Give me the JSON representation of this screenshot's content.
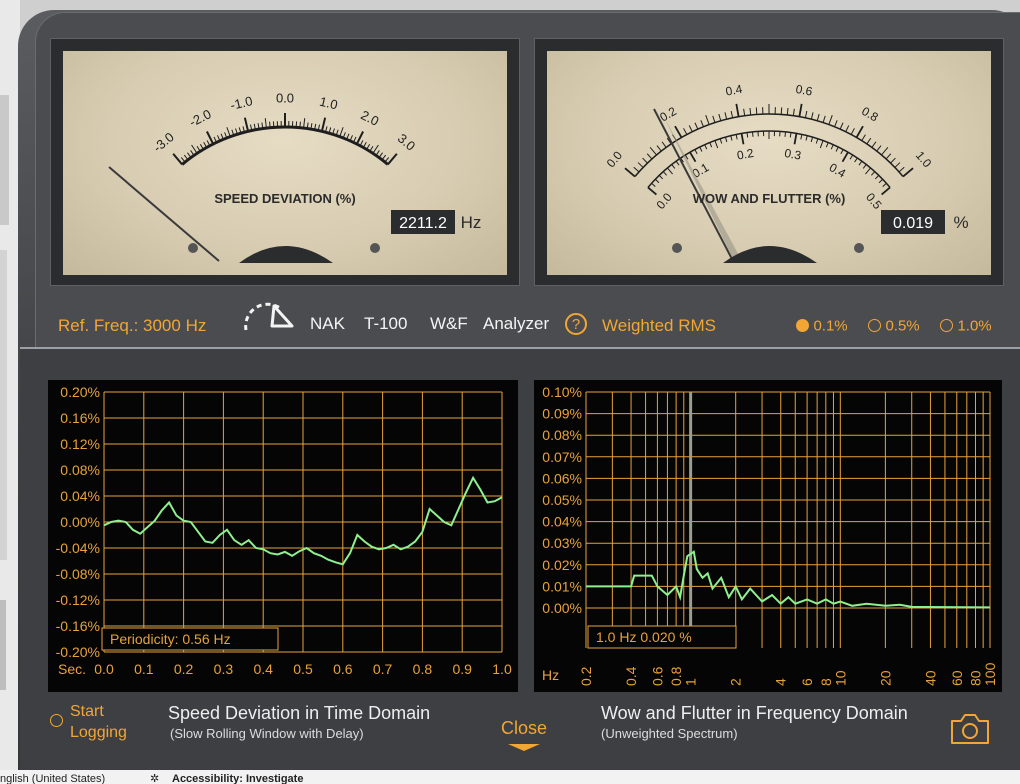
{
  "meters": {
    "speed": {
      "ticks": [
        "-3.0",
        "-2.0",
        "-1.0",
        "0.0",
        "1.0",
        "2.0",
        "3.0"
      ],
      "title": "SPEED DEVIATION (%)",
      "readout": "2211.2",
      "unit": "Hz"
    },
    "wow": {
      "outer_ticks": [
        "0.0",
        "0.2",
        "0.4",
        "0.6",
        "0.8",
        "1.0"
      ],
      "inner_ticks": [
        "0.0",
        "0.1",
        "0.2",
        "0.3",
        "0.4",
        "0.5"
      ],
      "title": "WOW AND FLUTTER (%)",
      "readout": "0.019",
      "unit": "%"
    }
  },
  "controls": {
    "ref_freq": "Ref. Freq.: 3000 Hz",
    "standards": [
      "NAK",
      "T-100",
      "W&F",
      "Analyzer"
    ],
    "help": "?",
    "weighting": "Weighted RMS",
    "ranges": [
      "0.1%",
      "0.5%",
      "1.0%"
    ],
    "selected_range": "0.1%"
  },
  "time_plot": {
    "y_labels": [
      "0.20%",
      "0.16%",
      "0.12%",
      "0.08%",
      "0.04%",
      "0.00%",
      "-0.04%",
      "-0.08%",
      "-0.12%",
      "-0.16%",
      "-0.20%"
    ],
    "x_title": "Sec.",
    "x_labels": [
      "0.0",
      "0.1",
      "0.2",
      "0.3",
      "0.4",
      "0.5",
      "0.6",
      "0.7",
      "0.8",
      "0.9",
      "1.0"
    ],
    "info": "Periodicity:   0.56 Hz",
    "caption": "Speed Deviation in Time Domain",
    "subcaption": "(Slow Rolling Window with Delay)"
  },
  "freq_plot": {
    "y_labels": [
      "0.10%",
      "0.09%",
      "0.08%",
      "0.07%",
      "0.06%",
      "0.05%",
      "0.04%",
      "0.03%",
      "0.02%",
      "0.01%",
      "0.00%"
    ],
    "x_title": "Hz",
    "x_labels": [
      "0.2",
      "0.4",
      "0.6",
      "0.8",
      "1",
      "2",
      "4",
      "6",
      "8",
      "10",
      "20",
      "40",
      "60",
      "80",
      "100"
    ],
    "info": "1.0 Hz        0.020 %",
    "caption": "Wow and Flutter in Frequency Domain",
    "subcaption": "(Unweighted Spectrum)"
  },
  "footer": {
    "start_logging": [
      "Start",
      "Logging"
    ],
    "close": "Close"
  },
  "statusbar": {
    "language": "nglish (United States)",
    "accessibility": "Accessibility: Investigate"
  },
  "colors": {
    "accent": "#f2a634",
    "trace": "#8ef08e",
    "grid": "#e8a23a",
    "meter_face": "#d8cdb2"
  }
}
